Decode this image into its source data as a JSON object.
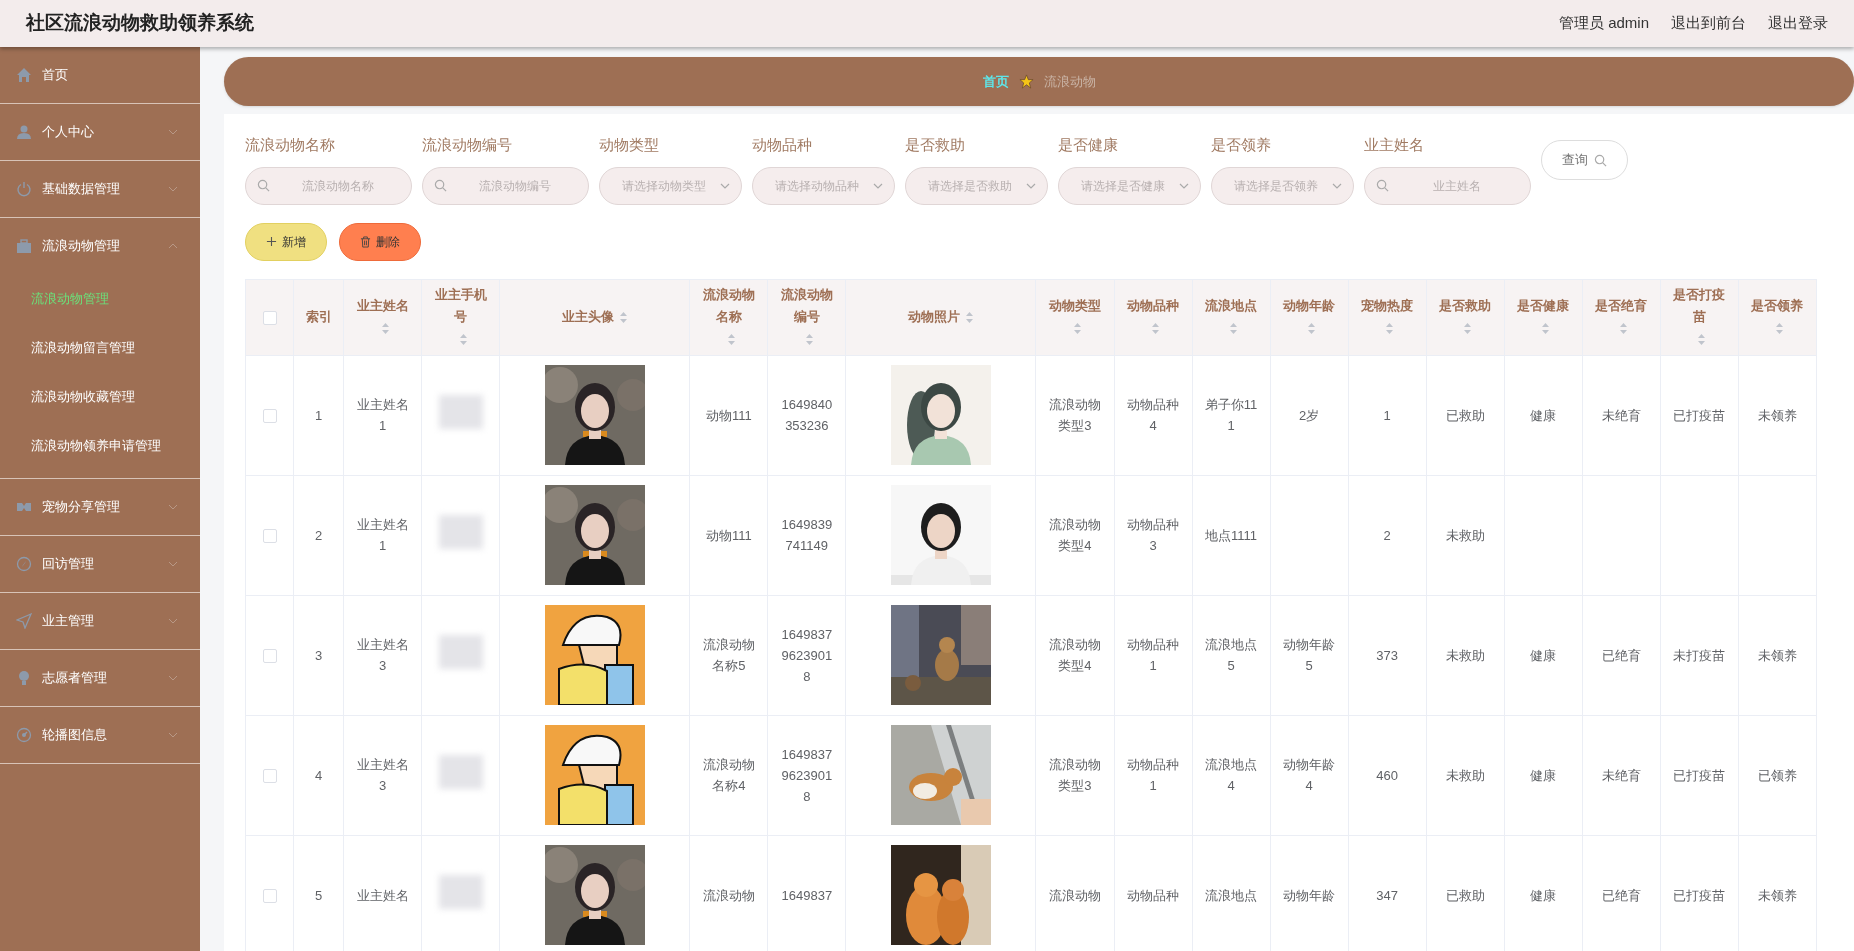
{
  "header": {
    "title": "社区流浪动物救助领养系统",
    "links": [
      "管理员 admin",
      "退出到前台",
      "退出登录"
    ]
  },
  "sidebar": {
    "items": [
      {
        "label": "首页",
        "kind": "link"
      },
      {
        "label": "个人中心",
        "kind": "menu",
        "expanded": false
      },
      {
        "label": "基础数据管理",
        "kind": "menu",
        "expanded": false
      },
      {
        "label": "流浪动物管理",
        "kind": "menu",
        "expanded": true,
        "children": [
          {
            "label": "流浪动物管理",
            "selected": true
          },
          {
            "label": "流浪动物留言管理",
            "selected": false
          },
          {
            "label": "流浪动物收藏管理",
            "selected": false
          },
          {
            "label": "流浪动物领养申请管理",
            "selected": false
          }
        ]
      },
      {
        "label": "宠物分享管理",
        "kind": "menu",
        "expanded": false
      },
      {
        "label": "回访管理",
        "kind": "menu",
        "expanded": false
      },
      {
        "label": "业主管理",
        "kind": "menu",
        "expanded": false
      },
      {
        "label": "志愿者管理",
        "kind": "menu",
        "expanded": false
      },
      {
        "label": "轮播图信息",
        "kind": "menu",
        "expanded": false
      }
    ]
  },
  "breadcrumb": [
    "首页",
    "流浪动物"
  ],
  "filters": [
    {
      "label": "流浪动物名称",
      "kind": "text",
      "placeholder": "流浪动物名称"
    },
    {
      "label": "流浪动物编号",
      "kind": "text",
      "placeholder": "流浪动物编号"
    },
    {
      "label": "动物类型",
      "kind": "select",
      "placeholder": "请选择动物类型"
    },
    {
      "label": "动物品种",
      "kind": "select",
      "placeholder": "请选择动物品种"
    },
    {
      "label": "是否救助",
      "kind": "select",
      "placeholder": "请选择是否救助"
    },
    {
      "label": "是否健康",
      "kind": "select",
      "placeholder": "请选择是否健康"
    },
    {
      "label": "是否领养",
      "kind": "select",
      "placeholder": "请选择是否领养"
    },
    {
      "label": "业主姓名",
      "kind": "text",
      "placeholder": "业主姓名"
    }
  ],
  "search_button": "查询",
  "actions": [
    {
      "label": "新增",
      "kind": "add"
    },
    {
      "label": "删除",
      "kind": "delete"
    }
  ],
  "table": {
    "select_all": {
      "checked": false
    },
    "columns": [
      {
        "label": "索引",
        "kind": "text",
        "sortable": false
      },
      {
        "label": "业主姓名",
        "kind": "text",
        "sortable": true
      },
      {
        "label": "业主手机号",
        "kind": "blurred",
        "sortable": true
      },
      {
        "label": "业主头像",
        "kind": "picture",
        "sortable": true
      },
      {
        "label": "流浪动物名称",
        "kind": "text",
        "sortable": true
      },
      {
        "label": "流浪动物编号",
        "kind": "text",
        "sortable": true
      },
      {
        "label": "动物照片",
        "kind": "picture",
        "sortable": true
      },
      {
        "label": "动物类型",
        "kind": "text",
        "sortable": true
      },
      {
        "label": "动物品种",
        "kind": "text",
        "sortable": true
      },
      {
        "label": "流浪地点",
        "kind": "text",
        "sortable": true
      },
      {
        "label": "动物年龄",
        "kind": "text",
        "sortable": true
      },
      {
        "label": "宠物热度",
        "kind": "text",
        "sortable": true
      },
      {
        "label": "是否救助",
        "kind": "text",
        "sortable": true
      },
      {
        "label": "是否健康",
        "kind": "text",
        "sortable": true
      },
      {
        "label": "是否绝育",
        "kind": "text",
        "sortable": true
      },
      {
        "label": "是否打疫苗",
        "kind": "text",
        "sortable": true
      },
      {
        "label": "是否领养",
        "kind": "text",
        "sortable": true
      }
    ],
    "rows": [
      {
        "checked": false,
        "cells": [
          "1",
          "业主姓名1",
          null,
          null,
          "动物111",
          "1649840353236",
          null,
          "流浪动物类型3",
          "动物品种4",
          "弟子你111",
          "2岁",
          "1",
          "已救助",
          "健康",
          "未绝育",
          "已打疫苗",
          "未领养"
        ]
      },
      {
        "checked": false,
        "cells": [
          "2",
          "业主姓名1",
          null,
          null,
          "动物111",
          "1649839741149",
          null,
          "流浪动物类型4",
          "动物品种3",
          "地点1111",
          null,
          "2",
          "未救助",
          null,
          null,
          null,
          null
        ]
      },
      {
        "checked": false,
        "cells": [
          "3",
          "业主姓名3",
          null,
          null,
          "流浪动物名称5",
          "164983796239018",
          null,
          "流浪动物类型4",
          "动物品种1",
          "流浪地点5",
          "动物年龄5",
          "373",
          "未救助",
          "健康",
          "已绝育",
          "未打疫苗",
          "未领养"
        ]
      },
      {
        "checked": false,
        "cells": [
          "4",
          "业主姓名3",
          null,
          null,
          "流浪动物名称4",
          "164983796239018",
          null,
          "流浪动物类型3",
          "动物品种1",
          "流浪地点4",
          "动物年龄4",
          "460",
          "未救助",
          "健康",
          "未绝育",
          "已打疫苗",
          "已领养"
        ]
      },
      {
        "checked": false,
        "cells": [
          "5",
          "业主姓名",
          null,
          null,
          "流浪动物",
          "1649837",
          null,
          "流浪动物",
          "动物品种",
          "流浪地点",
          "动物年龄",
          "347",
          "已救助",
          "健康",
          "已绝育",
          "已打疫苗",
          "未领养"
        ]
      }
    ]
  }
}
